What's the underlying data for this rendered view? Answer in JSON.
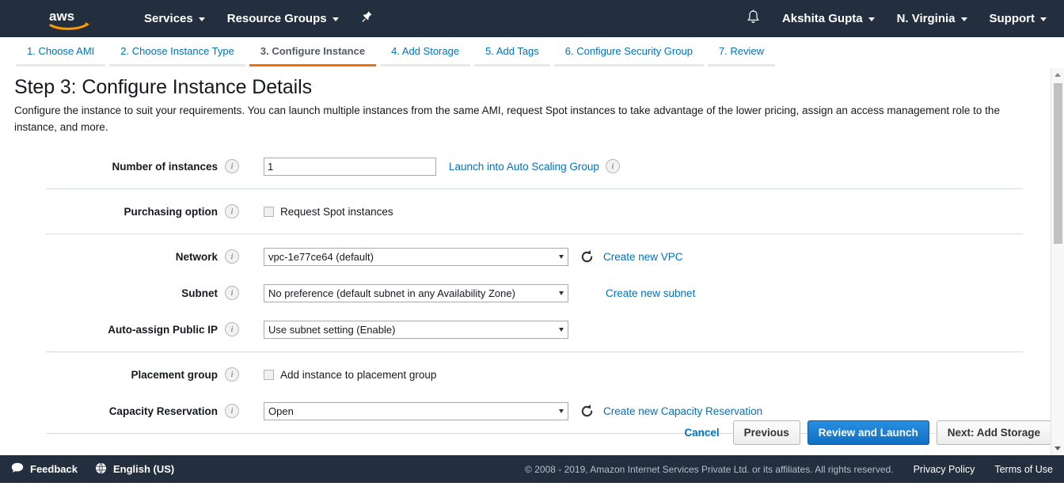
{
  "topnav": {
    "logo_alt": "aws",
    "services": "Services",
    "resource_groups": "Resource Groups",
    "pin_icon": "pin-icon",
    "bell_icon": "bell-icon",
    "user": "Akshita Gupta",
    "region": "N. Virginia",
    "support": "Support"
  },
  "steps": [
    {
      "label": "1. Choose AMI",
      "active": false
    },
    {
      "label": "2. Choose Instance Type",
      "active": false
    },
    {
      "label": "3. Configure Instance",
      "active": true
    },
    {
      "label": "4. Add Storage",
      "active": false
    },
    {
      "label": "5. Add Tags",
      "active": false
    },
    {
      "label": "6. Configure Security Group",
      "active": false
    },
    {
      "label": "7. Review",
      "active": false
    }
  ],
  "page": {
    "title": "Step 3: Configure Instance Details",
    "description": "Configure the instance to suit your requirements. You can launch multiple instances from the same AMI, request Spot instances to take advantage of the lower pricing, assign an access management role to the instance, and more."
  },
  "form": {
    "number_of_instances": {
      "label": "Number of instances",
      "value": "1",
      "link": "Launch into Auto Scaling Group"
    },
    "purchasing_option": {
      "label": "Purchasing option",
      "checkbox_label": "Request Spot instances",
      "checked": false
    },
    "network": {
      "label": "Network",
      "value": "vpc-1e77ce64 (default)",
      "link": "Create new VPC",
      "refresh_icon": "refresh-icon"
    },
    "subnet": {
      "label": "Subnet",
      "value": "No preference (default subnet in any Availability Zone)",
      "link": "Create new subnet"
    },
    "auto_assign_public_ip": {
      "label": "Auto-assign Public IP",
      "value": "Use subnet setting (Enable)"
    },
    "placement_group": {
      "label": "Placement group",
      "checkbox_label": "Add instance to placement group",
      "checked": false
    },
    "capacity_reservation": {
      "label": "Capacity Reservation",
      "value": "Open",
      "link": "Create new Capacity Reservation",
      "refresh_icon": "refresh-icon"
    }
  },
  "actions": {
    "cancel": "Cancel",
    "previous": "Previous",
    "review_and_launch": "Review and Launch",
    "next": "Next: Add Storage"
  },
  "footer": {
    "feedback": "Feedback",
    "language": "English (US)",
    "copyright": "© 2008 - 2019, Amazon Internet Services Private Ltd. or its affiliates. All rights reserved.",
    "privacy_policy": "Privacy Policy",
    "terms_of_use": "Terms of Use"
  },
  "colors": {
    "nav_background": "#232f3e",
    "accent_orange": "#ec7211",
    "link_blue": "#0073bb",
    "primary_button": "#0f6fc4"
  }
}
